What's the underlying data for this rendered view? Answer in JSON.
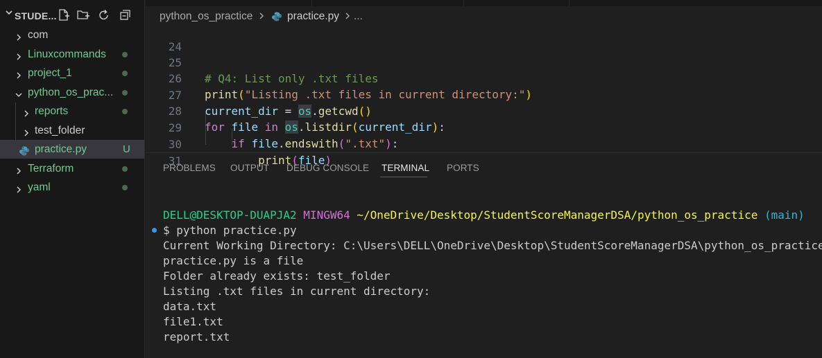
{
  "explorer": {
    "title": "STUDE...",
    "actions": [
      "new-file-icon",
      "new-folder-icon",
      "refresh-icon",
      "collapse-all-icon"
    ],
    "items": [
      {
        "label": "com",
        "type": "folder",
        "expanded": false,
        "status": ""
      },
      {
        "label": "Linuxcommands",
        "type": "folder",
        "expanded": false,
        "status": "dot"
      },
      {
        "label": "project_1",
        "type": "folder",
        "expanded": false,
        "status": "dot"
      },
      {
        "label": "python_os_prac...",
        "type": "folder",
        "expanded": true,
        "status": "dot"
      },
      {
        "label": "reports",
        "type": "folder",
        "expanded": false,
        "status": "dot"
      },
      {
        "label": "test_folder",
        "type": "folder",
        "expanded": false,
        "status": ""
      },
      {
        "label": "practice.py",
        "type": "file",
        "selected": true,
        "status": "U"
      },
      {
        "label": "Terraform",
        "type": "folder",
        "expanded": false,
        "status": "dot"
      },
      {
        "label": "yaml",
        "type": "folder",
        "expanded": false,
        "status": "dot"
      }
    ]
  },
  "breadcrumb": {
    "folder": "python_os_practice",
    "file": "practice.py",
    "more": "..."
  },
  "editor": {
    "line_numbers": [
      "24",
      "25",
      "26",
      "27",
      "28",
      "29",
      "30",
      "31"
    ],
    "lines": {
      "l25": "# Q4: List only .txt files",
      "l26_fn": "print",
      "l26_str": "\"Listing .txt files in current directory:\"",
      "l27_var": "current_dir",
      "l27_op": " = ",
      "l27_mod": "os",
      "l27_fn": "getcwd",
      "l28_kw1": "for",
      "l28_var1": "file",
      "l28_kw2": "in",
      "l28_mod": "os",
      "l28_fn": "listdir",
      "l28_var2": "current_dir",
      "l29_kw": "if",
      "l29_var": "file",
      "l29_fn": "endswith",
      "l29_str": "\".txt\"",
      "l30_fn": "print",
      "l30_var": "file"
    }
  },
  "panel": {
    "tabs": [
      "PROBLEMS",
      "OUTPUT",
      "DEBUG CONSOLE",
      "TERMINAL",
      "PORTS"
    ],
    "active_tab": "TERMINAL",
    "terminal": {
      "user_host": "DELL@DESKTOP-DUAPJA2",
      "shell": "MINGW64",
      "path": "~/OneDrive/Desktop/StudentScoreManagerDSA/python_os_practice",
      "branch": "(main)",
      "command": "$ python practice.py",
      "output": [
        "Current Working Directory: C:\\Users\\DELL\\OneDrive\\Desktop\\StudentScoreManagerDSA\\python_os_practice",
        "practice.py is a file",
        "Folder already exists: test_folder",
        "Listing .txt files in current directory:",
        "data.txt",
        "file1.txt",
        "report.txt"
      ]
    }
  }
}
